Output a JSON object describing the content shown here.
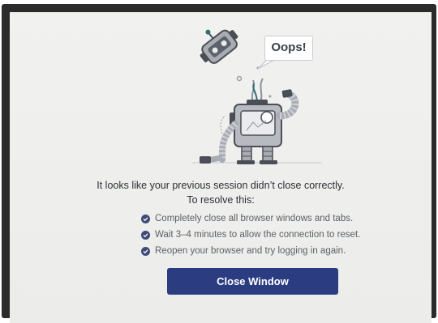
{
  "speech_bubble": {
    "text": "Oops!"
  },
  "message": {
    "heading": "It looks like your previous session didn’t close correctly.",
    "subheading": "To resolve this:",
    "steps": [
      {
        "text": "Completely close all browser windows and tabs.",
        "icon": "check-circle-icon"
      },
      {
        "text": "Wait 3–4 minutes to allow the connection to reset.",
        "icon": "check-circle-icon"
      },
      {
        "text": "Reopen your browser and try logging in again.",
        "icon": "check-circle-icon"
      }
    ]
  },
  "actions": {
    "close_label": "Close Window"
  },
  "colors": {
    "button_bg": "#2b3c80",
    "check_icon": "#3c4a78",
    "page_bg": "#efefed",
    "robot_body": "#a9adb3",
    "robot_dark": "#4a4f57",
    "robot_accent": "#2f6f78"
  }
}
